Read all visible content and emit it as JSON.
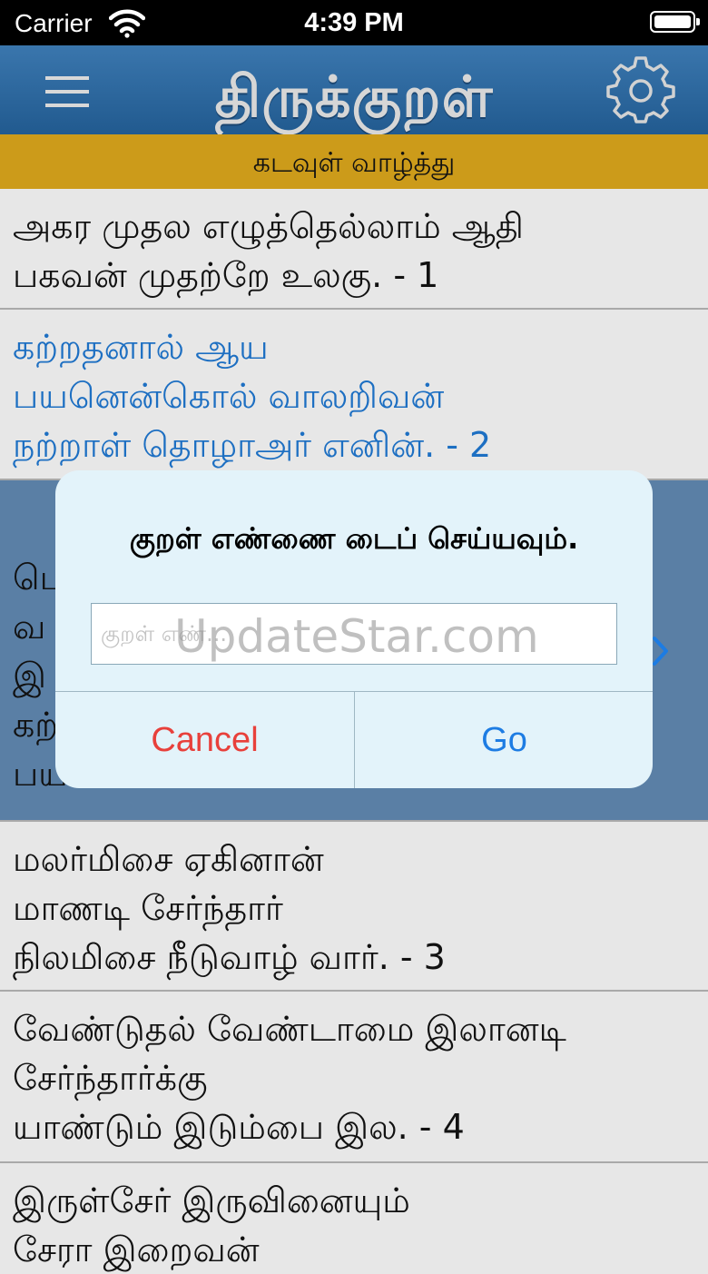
{
  "status_bar": {
    "carrier": "Carrier",
    "time": "4:39 PM"
  },
  "nav": {
    "title": "திருக்குறள்"
  },
  "chapter": {
    "title": "கடவுள் வாழ்த்து"
  },
  "kurals": [
    {
      "lines": [
        "அகர முதல எழுத்தெல்லாம் ஆதி",
        "பகவன் முதற்றே உலகு.  - 1"
      ]
    },
    {
      "lines": [
        "கற்றதனால் ஆய",
        "பயனென்கொல் வாலறிவன்",
        "நற்றாள் தொழாஅர் எனின்.  - 2"
      ]
    },
    {
      "lines": [
        "பெ",
        "வ",
        "இ",
        "கற்",
        "பய"
      ]
    },
    {
      "lines": [
        "மலர்மிசை ஏகினான்",
        "மாணடி சேர்ந்தார்",
        "நிலமிசை நீடுவாழ் வார்.   - 3"
      ]
    },
    {
      "lines": [
        "வேண்டுதல் வேண்டாமை இலானடி",
        "சேர்ந்தார்க்கு",
        "யாண்டும் இடும்பை இல. - 4"
      ]
    },
    {
      "lines": [
        "இருள்சேர் இருவினையும்",
        "சேரா இறைவன்"
      ]
    }
  ],
  "dialog": {
    "message": "குறள் எண்ணை டைப் செய்யவும்.",
    "input_placeholder": "குறள் எண்...",
    "cancel_label": "Cancel",
    "go_label": "Go"
  },
  "watermark": "UpdateStar.com"
}
